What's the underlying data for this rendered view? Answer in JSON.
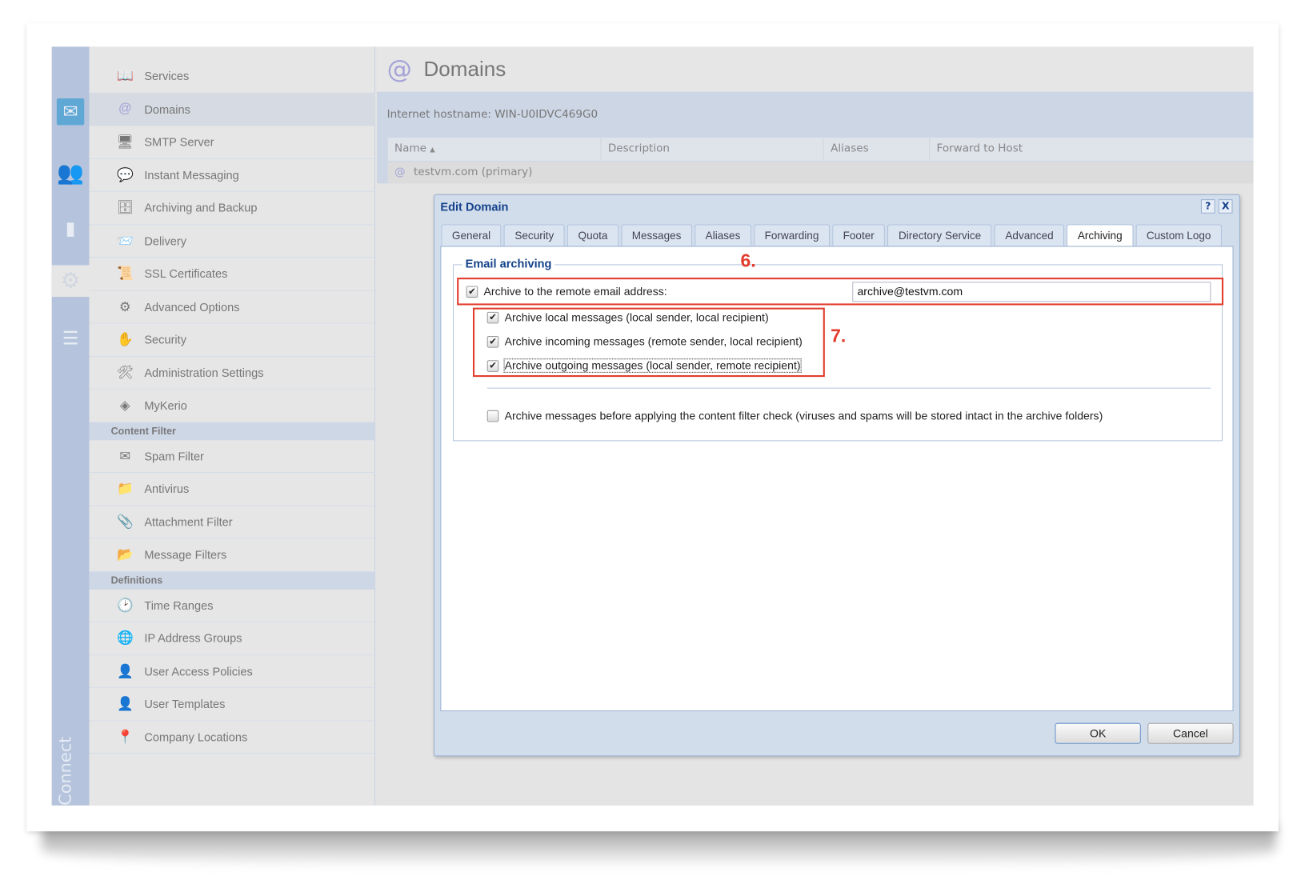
{
  "nav_strip": {
    "icons": [
      "mail-icon",
      "users-icon",
      "statistics-icon",
      "settings-icon",
      "logs-icon"
    ],
    "active": "settings-icon",
    "footer_label": "Connect"
  },
  "sidebar": {
    "items": [
      {
        "label": "Services",
        "icon": "services-icon"
      },
      {
        "label": "Domains",
        "icon": "at-icon",
        "selected": true
      },
      {
        "label": "SMTP Server",
        "icon": "smtp-server-icon"
      },
      {
        "label": "Instant Messaging",
        "icon": "chat-icon"
      },
      {
        "label": "Archiving and Backup",
        "icon": "archive-icon"
      },
      {
        "label": "Delivery",
        "icon": "delivery-icon"
      },
      {
        "label": "SSL Certificates",
        "icon": "certificate-icon"
      },
      {
        "label": "Advanced Options",
        "icon": "gears-icon"
      },
      {
        "label": "Security",
        "icon": "stop-hand-icon"
      },
      {
        "label": "Administration Settings",
        "icon": "admin-settings-icon"
      },
      {
        "label": "MyKerio",
        "icon": "mykerio-icon"
      }
    ],
    "content_filter": {
      "title": "Content Filter",
      "items": [
        {
          "label": "Spam Filter",
          "icon": "spam-icon"
        },
        {
          "label": "Antivirus",
          "icon": "antivirus-icon"
        },
        {
          "label": "Attachment Filter",
          "icon": "attachment-filter-icon"
        },
        {
          "label": "Message Filters",
          "icon": "filter-folder-icon"
        }
      ]
    },
    "definitions": {
      "title": "Definitions",
      "items": [
        {
          "label": "Time Ranges",
          "icon": "time-ranges-icon"
        },
        {
          "label": "IP Address Groups",
          "icon": "ip-groups-icon"
        },
        {
          "label": "User Access Policies",
          "icon": "user-policy-icon"
        },
        {
          "label": "User Templates",
          "icon": "user-template-icon"
        },
        {
          "label": "Company Locations",
          "icon": "location-icon"
        }
      ]
    }
  },
  "main": {
    "title": "Domains",
    "hostname": "Internet hostname: WIN-U0IDVC469G0",
    "columns": [
      "Name",
      "Description",
      "Aliases",
      "Forward to Host"
    ],
    "sort_indicator": "▲",
    "rows": [
      {
        "name": "testvm.com (primary)"
      }
    ]
  },
  "dialog": {
    "title": "Edit Domain",
    "help": "?",
    "close": "X",
    "tabs": [
      "General",
      "Security",
      "Quota",
      "Messages",
      "Aliases",
      "Forwarding",
      "Footer",
      "Directory Service",
      "Advanced",
      "Archiving",
      "Custom Logo"
    ],
    "active_tab": "Archiving",
    "fieldset": "Email archiving",
    "remote": {
      "label": "Archive to the remote email address:",
      "checked": true,
      "value": "archive@testvm.com"
    },
    "options": [
      {
        "label": "Archive local messages (local sender, local recipient)",
        "checked": true
      },
      {
        "label": "Archive incoming messages (remote sender, local recipient)",
        "checked": true
      },
      {
        "label": "Archive outgoing messages (local sender, remote recipient)",
        "checked": true
      }
    ],
    "before_filter": {
      "label": "Archive messages before applying the content filter check (viruses and spams will be stored intact in the archive folders)",
      "checked": false
    },
    "ok": "OK",
    "cancel": "Cancel"
  },
  "annotations": {
    "step6": "6.",
    "step7": "7.",
    "color": "#e23c2c"
  }
}
